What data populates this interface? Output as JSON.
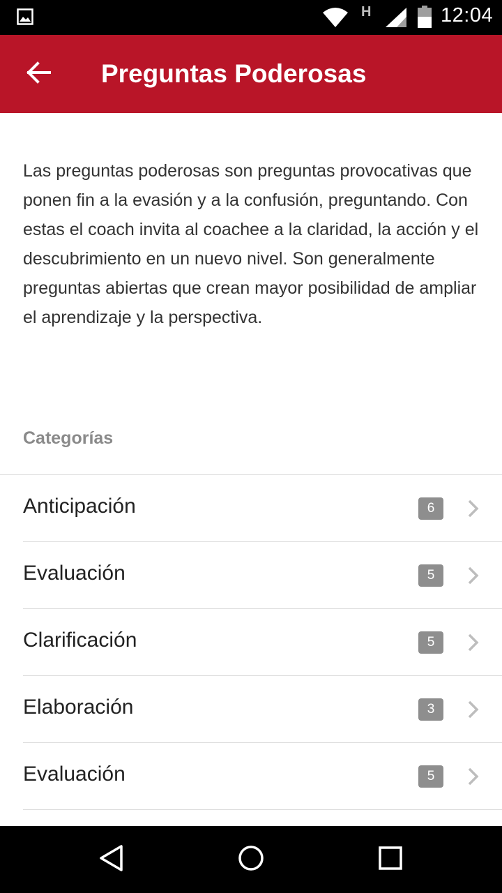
{
  "status_bar": {
    "network_label": "H",
    "time": "12:04",
    "icons": [
      "image-icon",
      "wifi-icon",
      "signal-icon",
      "battery-icon"
    ]
  },
  "app_bar": {
    "title": "Preguntas Poderosas",
    "back_icon": "arrow-back-icon",
    "color": "#b91528"
  },
  "intro": {
    "text": "Las preguntas poderosas son preguntas provocativas que ponen fin a la evasión y a la confusión, preguntando. Con estas el coach invita al coachee a la claridad, la acción y el descubrimiento en un nuevo nivel. Son generalmente preguntas abiertas que crean mayor posibilidad de ampliar el aprendizaje y la perspectiva."
  },
  "categories": {
    "heading": "Categorías",
    "items": [
      {
        "label": "Anticipación",
        "count": "6"
      },
      {
        "label": "Evaluación",
        "count": "5"
      },
      {
        "label": "Clarificación",
        "count": "5"
      },
      {
        "label": "Elaboración",
        "count": "3"
      },
      {
        "label": "Evaluación",
        "count": "5"
      }
    ]
  },
  "nav_bar": {
    "icons": [
      "nav-back-icon",
      "home-icon",
      "recents-icon"
    ]
  }
}
